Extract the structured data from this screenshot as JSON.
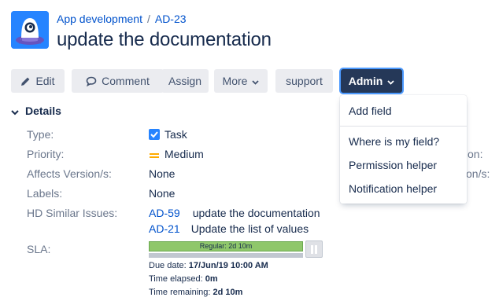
{
  "breadcrumb": {
    "project": "App development",
    "separator": "/",
    "issue_key": "AD-23"
  },
  "issue": {
    "title": "update the documentation"
  },
  "toolbar": {
    "edit": "Edit",
    "comment": "Comment",
    "assign": "Assign",
    "more": "More",
    "support": "support",
    "admin": "Admin"
  },
  "details": {
    "heading": "Details",
    "fields": [
      {
        "label": "Type:",
        "value": "Task"
      },
      {
        "label": "Priority:",
        "value": "Medium"
      },
      {
        "label": "Affects Version/s:",
        "value": "None"
      },
      {
        "label": "Labels:",
        "value": "None"
      },
      {
        "label": "HD Similar Issues:"
      },
      {
        "label": "SLA:"
      }
    ],
    "similar_issues": [
      {
        "key": "AD-59",
        "summary": "update the documentation"
      },
      {
        "key": "AD-21",
        "summary": "Update the list of values"
      }
    ]
  },
  "sla": {
    "bar_label": "Regular: 2d 10m",
    "due_label": "Due date:",
    "due_value": "17/Jun/19 10:00 AM",
    "elapsed_label": "Time elapsed:",
    "elapsed_value": "0m",
    "remaining_label": "Time remaining:",
    "remaining_value": "2d 10m"
  },
  "admin_menu": {
    "items": [
      "Add field",
      "Where is my field?",
      "Permission helper",
      "Notification helper"
    ]
  },
  "hidden_fragments": {
    "right_1": "on:",
    "right_2": "on/s:"
  },
  "colors": {
    "link": "#0052cc",
    "admin_bg": "#253858",
    "focus_ring": "#4c9aff",
    "sla_green": "#8fc76b",
    "priority": "#ffab00"
  },
  "icons": [
    "project-avatar-icon",
    "pencil-icon",
    "comment-icon",
    "chevron-down-icon",
    "task-checkbox-icon",
    "priority-medium-icon",
    "pause-icon"
  ]
}
